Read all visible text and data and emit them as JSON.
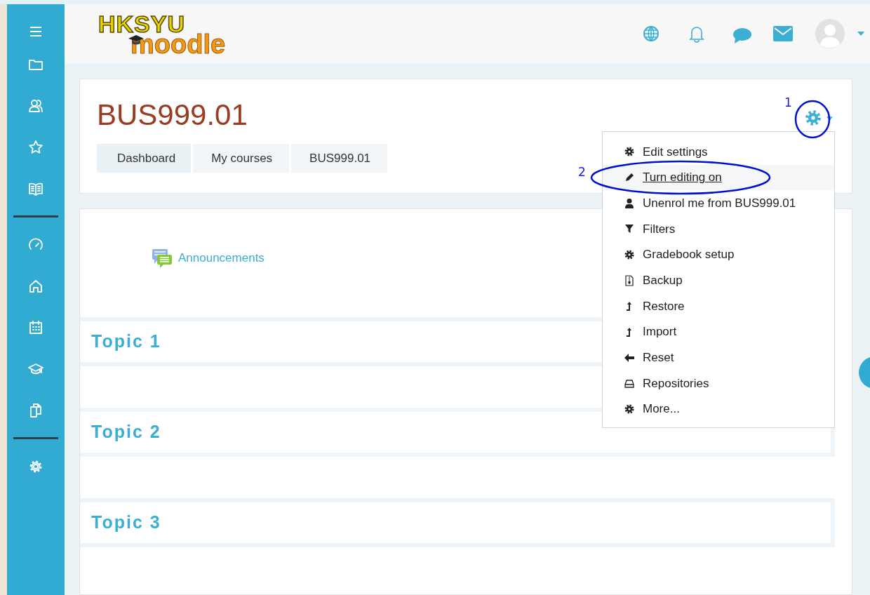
{
  "logo": {
    "top": "HKSYU",
    "bottom": "moodle"
  },
  "course": {
    "title": "BUS999.01",
    "breadcrumb": [
      "Dashboard",
      "My courses",
      "BUS999.01"
    ]
  },
  "activity": {
    "label": "Announcements"
  },
  "topics": [
    "Topic 1",
    "Topic 2",
    "Topic 3"
  ],
  "settings_menu": [
    {
      "label": "Edit settings",
      "selected": false
    },
    {
      "label": "Turn editing on",
      "selected": true
    },
    {
      "label": "Unenrol me from BUS999.01",
      "selected": false
    },
    {
      "label": "Filters",
      "selected": false
    },
    {
      "label": "Gradebook setup",
      "selected": false
    },
    {
      "label": "Backup",
      "selected": false
    },
    {
      "label": "Restore",
      "selected": false
    },
    {
      "label": "Import",
      "selected": false
    },
    {
      "label": "Reset",
      "selected": false
    },
    {
      "label": "Repositories",
      "selected": false
    },
    {
      "label": "More...",
      "selected": false
    }
  ],
  "annotations": [
    "1",
    "2"
  ]
}
